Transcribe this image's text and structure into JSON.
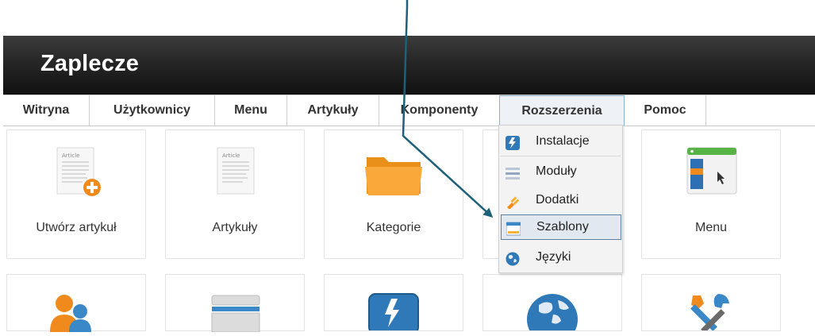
{
  "header": {
    "title": "Zaplecze"
  },
  "menu": [
    {
      "label": "Witryna"
    },
    {
      "label": "Użytkownicy"
    },
    {
      "label": "Menu"
    },
    {
      "label": "Artykuły"
    },
    {
      "label": "Komponenty"
    },
    {
      "label": "Rozszerzenia"
    },
    {
      "label": "Pomoc"
    }
  ],
  "tiles": [
    {
      "label": "Utwórz artykuł"
    },
    {
      "label": "Artykuły"
    },
    {
      "label": "Kategorie"
    },
    {
      "label": ""
    },
    {
      "label": "Menu"
    }
  ],
  "dropdown": {
    "items": [
      {
        "label": "Instalacje"
      },
      {
        "label": "Moduły"
      },
      {
        "label": "Dodatki"
      },
      {
        "label": "Szablony"
      },
      {
        "label": "Języki"
      }
    ],
    "selected": "Szablony"
  },
  "icons": {
    "article_text": "Article"
  },
  "colors": {
    "arrow": "#1c6079",
    "highlight_border": "#5d7fa3",
    "folder": "#f4a126"
  }
}
